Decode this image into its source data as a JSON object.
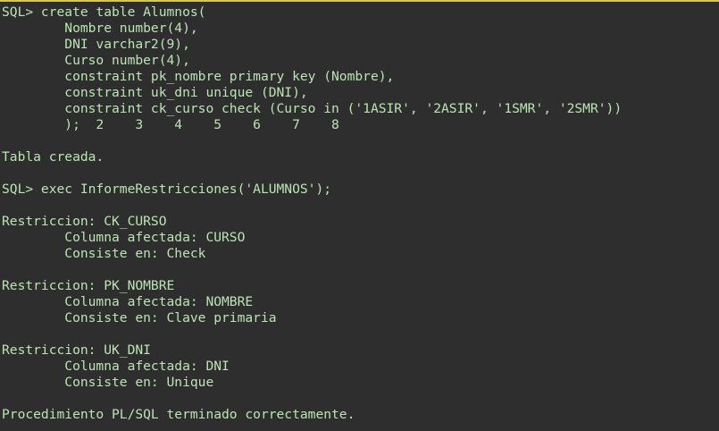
{
  "terminal": {
    "lines": [
      "SQL> create table Alumnos(",
      "        Nombre number(4),",
      "        DNI varchar2(9),",
      "        Curso number(4),",
      "        constraint pk_nombre primary key (Nombre),",
      "        constraint uk_dni unique (DNI),",
      "        constraint ck_curso check (Curso in ('1ASIR', '2ASIR', '1SMR', '2SMR'))",
      "        );  2    3    4    5    6    7    8",
      "",
      "Tabla creada.",
      "",
      "SQL> exec InformeRestricciones('ALUMNOS');",
      "",
      "Restriccion: CK_CURSO",
      "        Columna afectada: CURSO",
      "        Consiste en: Check",
      "",
      "Restriccion: PK_NOMBRE",
      "        Columna afectada: NOMBRE",
      "        Consiste en: Clave primaria",
      "",
      "Restriccion: UK_DNI",
      "        Columna afectada: DNI",
      "        Consiste en: Unique",
      "",
      "Procedimiento PL/SQL terminado correctamente."
    ]
  },
  "colors": {
    "background": "#2e2e2e",
    "text": "#b9e6b1",
    "top_border": "#d8c84a"
  }
}
